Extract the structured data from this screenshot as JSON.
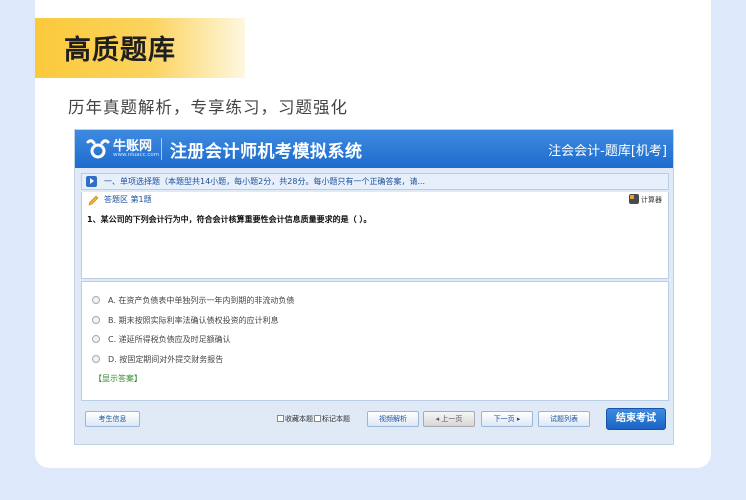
{
  "promo": {
    "title": "高质题库",
    "subtitle": "历年真题解析，专享练习，习题强化"
  },
  "app": {
    "logo_name": "牛账网",
    "logo_url": "www.niuacc.com",
    "system_title": "注册会计师机考模拟系统",
    "subject_title": "注会会计-题库[机考]",
    "section_header": "一、单项选择题（本题型共14小题，每小题2分，共28分。每小题只有一个正确答案，请...",
    "answer_area_label": "答题区 第1题",
    "calculator_label": "计算器",
    "question": "1、某公司的下列会计行为中，符合会计核算重要性会计信息质量要求的是（ ）。",
    "options": [
      "A. 在资产负债表中单独列示一年内到期的非流动负债",
      "B. 期末按照实际利率法确认债权投资的应计利息",
      "C. 递延所得税负债应及时足额确认",
      "D. 按固定期间对外提交财务报告"
    ],
    "show_answer": "【显示答案】",
    "bottom": {
      "candidate_info": "考生信息",
      "bookmark": "收藏本题",
      "mark": "标记本题",
      "view_analysis": "视频解析",
      "prev": "◂ 上一页",
      "next": "下一页 ▸",
      "question_list": "试题列表",
      "end_exam": "结束考试"
    }
  },
  "colors": {
    "accent_yellow": "#fbc93a",
    "header_blue": "#1d6bcc",
    "page_bg": "#dde9fb"
  }
}
